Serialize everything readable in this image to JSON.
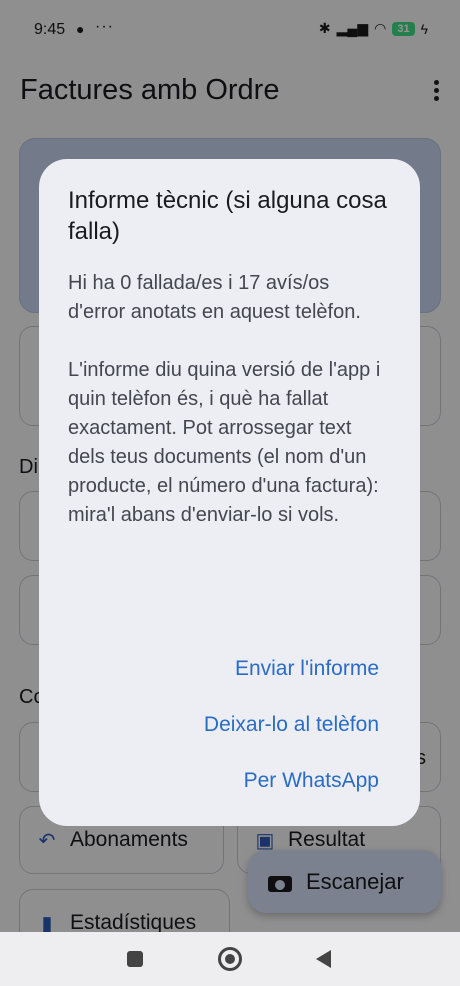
{
  "status_bar": {
    "time": "9:45",
    "battery": "31"
  },
  "app_bar": {
    "title": "Factures amb Ordre"
  },
  "sections": {
    "section1_peek": "Di",
    "section2_peek": "Co"
  },
  "cards": {
    "c4_peek": "s"
  },
  "chips": {
    "abonaments": "Abonaments",
    "resultat": "Resultat",
    "estadistiques": "Estadístiques"
  },
  "fab": {
    "label": "Escanejar"
  },
  "dialog": {
    "title": "Informe tècnic (si alguna cosa falla)",
    "body": "Hi ha 0 fallada/es i 17 avís/os d'error anotats en aquest telèfon.\n\nL'informe diu quina versió de l'app i quin telèfon és, i què ha fallat exactament. Pot arrossegar text dels teus documents (el nom d'un producte, el número d'una factura): mira'l abans d'enviar-lo si vols.",
    "actions": {
      "send": "Enviar l'informe",
      "keep": "Deixar-lo al telèfon",
      "whatsapp": "Per WhatsApp"
    }
  },
  "colors": {
    "accent": "#2a6cc4",
    "dialog_bg": "#eceef4",
    "hero_card": "#c7d4f0"
  }
}
